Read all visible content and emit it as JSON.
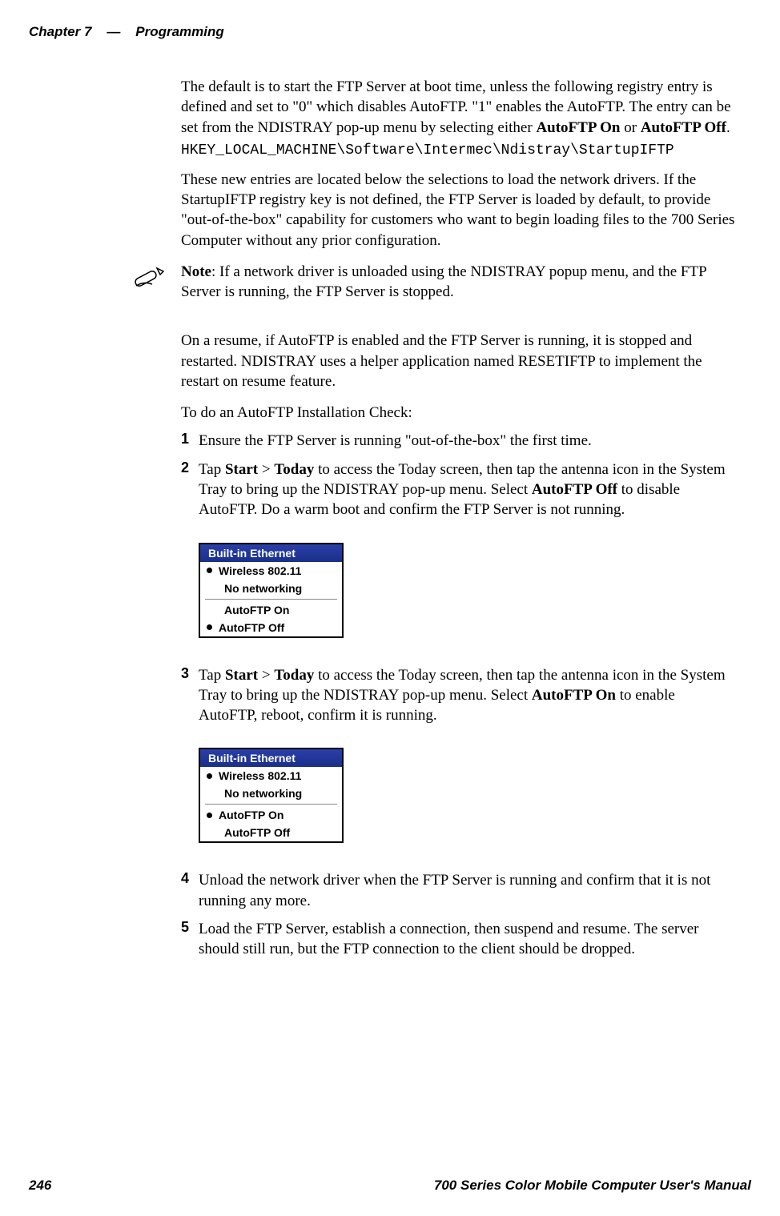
{
  "header": {
    "chapter": "Chapter 7",
    "dash": "—",
    "title": "Programming"
  },
  "para1_pre": "The default is to start the FTP Server at boot time, unless the following registry entry is defined and set to \"0\" which disables AutoFTP. \"1\" enables the AutoFTP. The entry can be set from the NDISTRAY pop-up menu by selecting either ",
  "autoftp_on": "AutoFTP On",
  "or_word": " or ",
  "autoftp_off": "AutoFTP Off",
  "period": ".",
  "regkey": "HKEY_LOCAL_MACHINE\\Software\\Intermec\\Ndistray\\StartupIFTP",
  "para2": "These new entries are located below the selections to load the network drivers. If the StartupIFTP registry key is not defined, the FTP Server is loaded by default, to provide \"out-of-the-box\" capability for customers who want to begin loading files to the 700 Series Computer without any prior configuration.",
  "note_label": "Note",
  "note_text": ": If a network driver is unloaded using the NDISTRAY popup menu, and the FTP Server is running, the FTP Server is stopped.",
  "para3": "On a resume, if AutoFTP is enabled and the FTP Server is running, it is stopped and restarted. NDISTRAY uses a helper application named RESETIFTP to implement the restart on resume feature.",
  "para4": "To do an AutoFTP Installation Check:",
  "list": {
    "n1": "1",
    "t1": "Ensure the FTP Server is running \"out-of-the-box\" the first time.",
    "n2": "2",
    "t2_pre": "Tap ",
    "t2_start": "Start",
    "t2_gt": " > ",
    "t2_today": "Today",
    "t2_mid": " to access the Today screen, then tap the antenna icon in the System Tray to bring up the NDISTRAY pop-up menu. Select ",
    "t2_off": "AutoFTP Off",
    "t2_end": " to disable AutoFTP. Do a warm boot and confirm the FTP Server is not running.",
    "n3": "3",
    "t3_pre": "Tap ",
    "t3_start": "Start",
    "t3_gt": " > ",
    "t3_today": "Today",
    "t3_mid": " to access the Today screen, then tap the antenna icon in the System Tray to bring up the NDISTRAY pop-up menu. Select ",
    "t3_on": "AutoFTP On",
    "t3_end": " to enable AutoFTP, reboot, confirm it is running.",
    "n4": "4",
    "t4": "Unload the network driver when the FTP Server is running and confirm that it is not running any more.",
    "n5": "5",
    "t5": "Load the FTP Server, establish a connection, then suspend and resume. The server should still run, but the FTP connection to the client should be dropped."
  },
  "menu1": {
    "title": "Built-in Ethernet",
    "wireless": "Wireless 802.11",
    "nonet": "No networking",
    "aon": "AutoFTP On",
    "aoff": "AutoFTP Off"
  },
  "menu2": {
    "title": "Built-in Ethernet",
    "wireless": "Wireless 802.11",
    "nonet": "No networking",
    "aon": "AutoFTP On",
    "aoff": "AutoFTP Off"
  },
  "footer": {
    "page": "246",
    "title": "700 Series Color Mobile Computer User's Manual"
  }
}
